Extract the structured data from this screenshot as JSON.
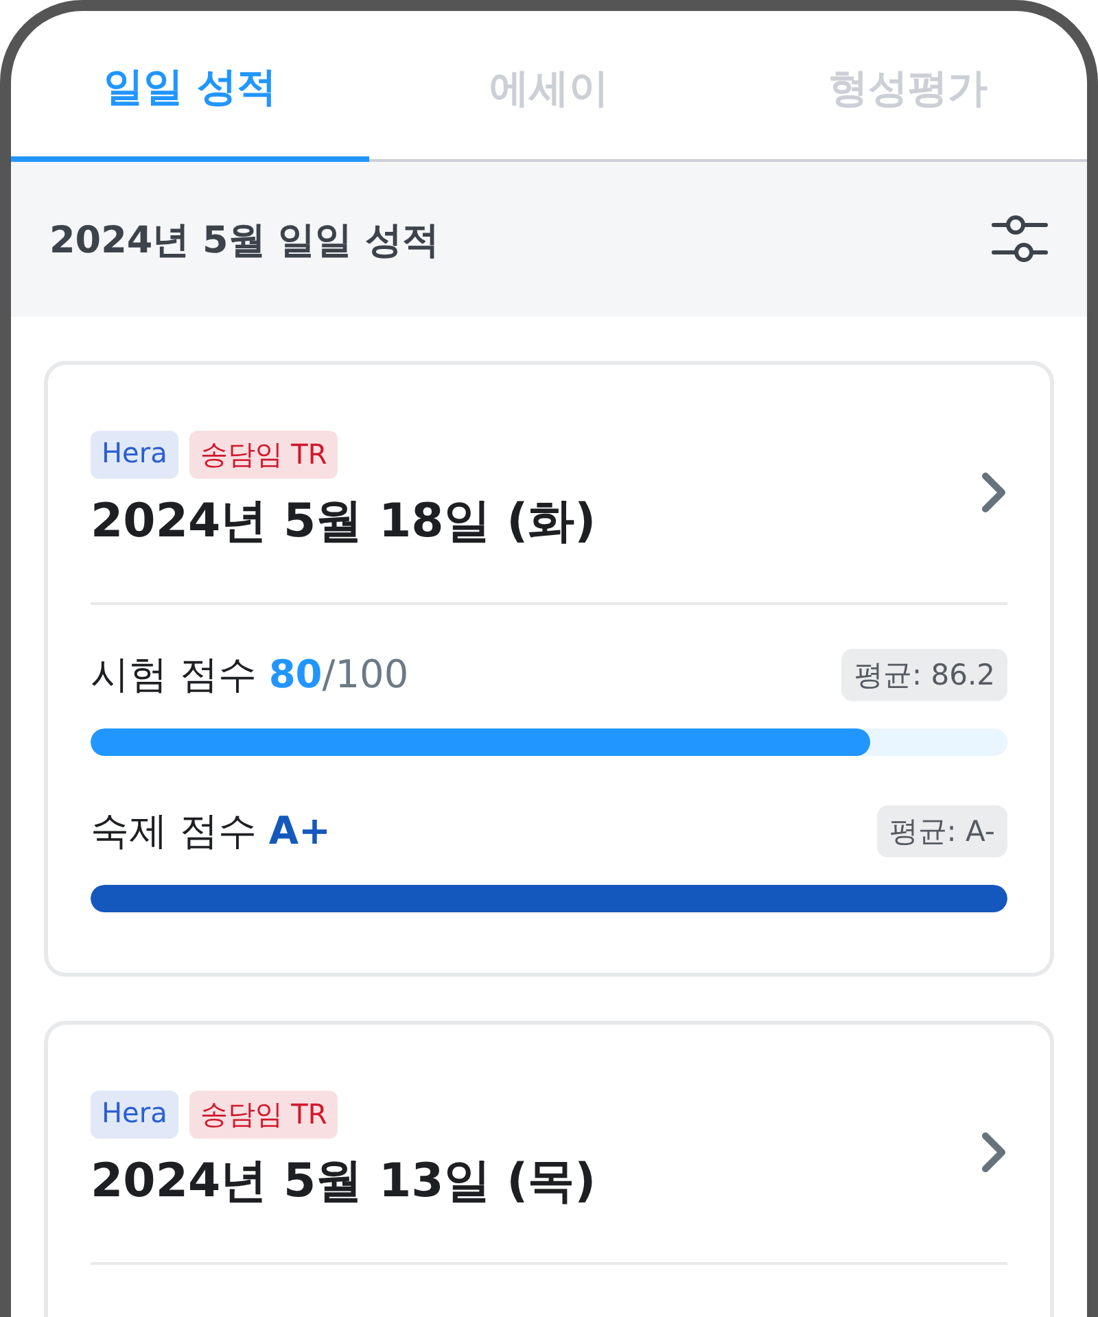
{
  "tabs": [
    {
      "label": "일일 성적",
      "selected": true
    },
    {
      "label": "에세이",
      "selected": false
    },
    {
      "label": "형성평가",
      "selected": false
    }
  ],
  "header": {
    "title": "2024년 5월 일일 성적"
  },
  "cards": [
    {
      "tags": [
        {
          "label": "Hera",
          "color": "#2b5fd0"
        },
        {
          "label": "송담임 TR",
          "color": "#d0182c"
        }
      ],
      "title": "2024년 5월 18일 (화)",
      "scores": [
        {
          "label": "시험 점수",
          "value": "80",
          "max": "/100",
          "average": "평균: 86.2",
          "level": 0.85,
          "color": "#2196ff"
        },
        {
          "label": "숙제 점수",
          "value": "A+",
          "average": "평균: A-",
          "level": 1,
          "color": "#1558bd"
        }
      ]
    },
    {
      "tags": [
        {
          "label": "Hera",
          "color": "#2b5fd0"
        },
        {
          "label": "송담임 TR",
          "color": "#d0182c"
        }
      ],
      "title": "2024년 5월 13일 (목)"
    }
  ]
}
